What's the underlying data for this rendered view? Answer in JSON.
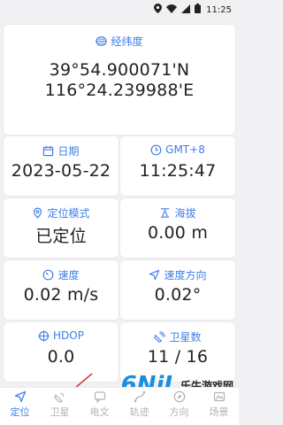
{
  "status_bar": {
    "time": "11:25",
    "icons": [
      "location-icon",
      "wifi-icon",
      "signal-icon",
      "battery-icon"
    ]
  },
  "coordinates": {
    "label": "经纬度",
    "latitude": "39°54.900071'N",
    "longitude": "116°24.239988'E"
  },
  "cards": {
    "date": {
      "label": "日期",
      "value": "2023-05-22"
    },
    "time": {
      "label": "GMT+8",
      "value": "11:25:47"
    },
    "mode": {
      "label": "定位模式",
      "value": "已定位"
    },
    "altitude": {
      "label": "海拔",
      "value": "0.00 m"
    },
    "speed": {
      "label": "速度",
      "value": "0.02 m/s"
    },
    "heading": {
      "label": "速度方向",
      "value": "0.02°"
    },
    "hdop": {
      "label": "HDOP",
      "value": "0.0"
    },
    "satellites": {
      "label": "卫星数",
      "value": "11 / 16"
    }
  },
  "tabs": [
    {
      "label": "定位",
      "icon": "navigation-icon",
      "active": true
    },
    {
      "label": "卫星",
      "icon": "satellite-icon",
      "active": false
    },
    {
      "label": "电文",
      "icon": "message-icon",
      "active": false
    },
    {
      "label": "轨迹",
      "icon": "track-icon",
      "active": false
    },
    {
      "label": "方向",
      "icon": "compass-icon",
      "active": false
    },
    {
      "label": "场景",
      "icon": "scene-icon",
      "active": false
    }
  ],
  "watermark": {
    "logo": "6NiL",
    "text": "乐牛游戏网"
  },
  "colors": {
    "accent": "#3f7fe6",
    "background": "#f1f1f3",
    "inactive_tab": "#b3b3b8",
    "arrow": "#d33c3c"
  }
}
